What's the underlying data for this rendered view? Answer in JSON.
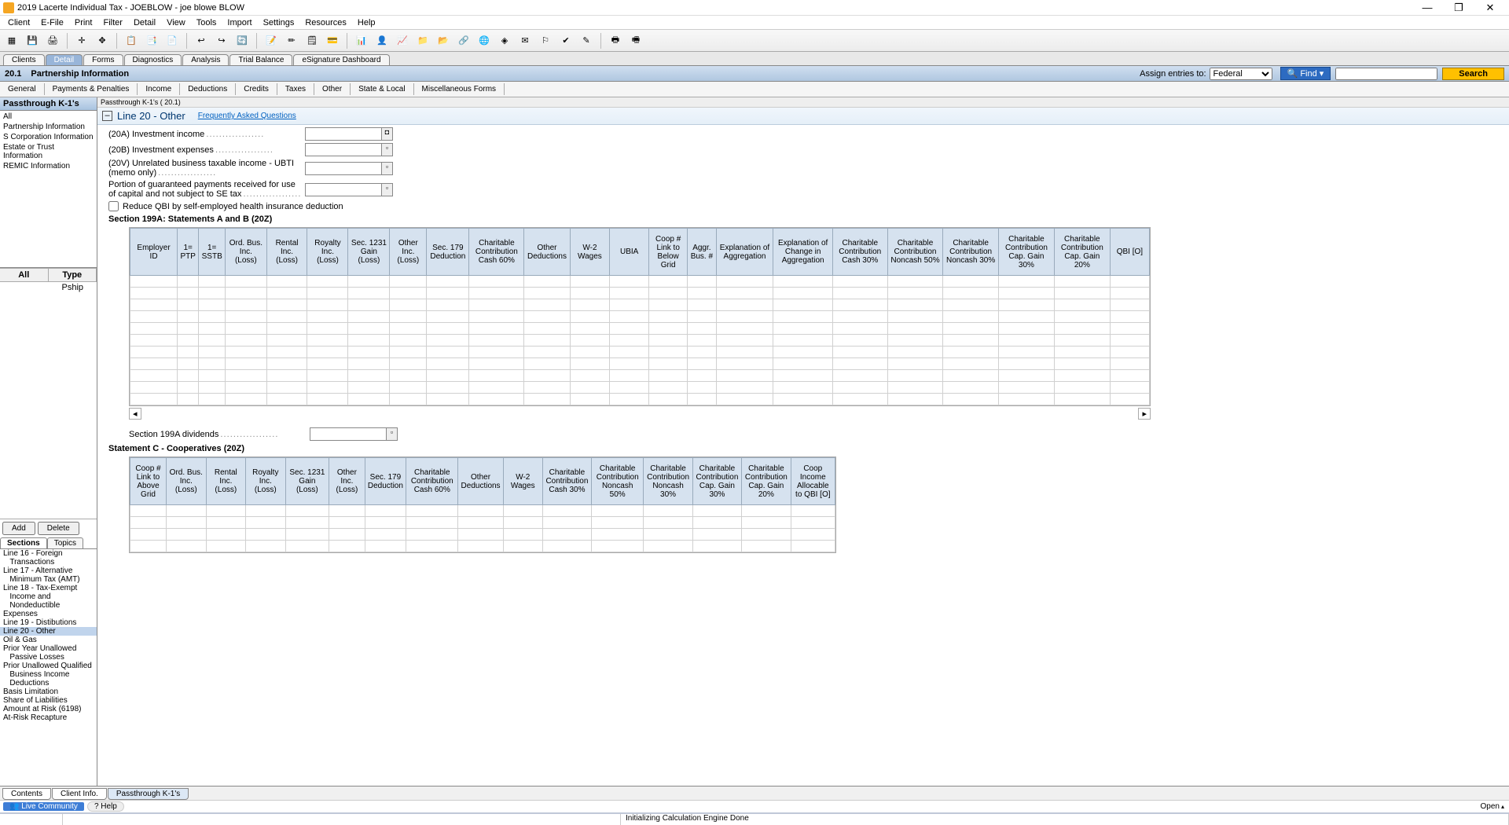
{
  "window": {
    "title": "2019 Lacerte Individual Tax - JOEBLOW - joe blowe BLOW"
  },
  "menu": [
    "Client",
    "E-File",
    "Print",
    "Filter",
    "Detail",
    "View",
    "Tools",
    "Import",
    "Settings",
    "Resources",
    "Help"
  ],
  "nav_tabs": [
    "Clients",
    "Detail",
    "Forms",
    "Diagnostics",
    "Analysis",
    "Trial Balance",
    "eSignature Dashboard"
  ],
  "nav_active": 1,
  "header": {
    "id": "20.1",
    "title": "Partnership Information",
    "assign_label": "Assign entries to:",
    "assign_value": "Federal",
    "find_label": "Find ▾",
    "search_label": "Search"
  },
  "sub_tabs": [
    "General",
    "Payments & Penalties",
    "Income",
    "Deductions",
    "Credits",
    "Taxes",
    "Other",
    "State & Local",
    "Miscellaneous Forms"
  ],
  "left": {
    "panel1_title": "Passthrough K-1's",
    "panel1_items": [
      "All",
      "Partnership Information",
      "S Corporation Information",
      "Estate or Trust Information",
      "REMIC Information"
    ],
    "grid_cols": [
      "All",
      "Type"
    ],
    "grid_row_type": "Pship",
    "add": "Add",
    "delete": "Delete",
    "sec_tabs": [
      "Sections",
      "Topics"
    ],
    "sections": [
      "Line 16 - Foreign\n   Transactions",
      "Line 17 - Alternative\n   Minimum Tax (AMT)",
      "Line 18 - Tax-Exempt\n   Income and\n   Nondeductible Expenses",
      "Line 19 - Distibutions",
      "Line 20 - Other",
      "Oil & Gas",
      "Prior Year Unallowed\n   Passive Losses",
      "Prior Unallowed Qualified\n   Business Income\n   Deductions",
      "Basis Limitation",
      "Share of Liabilities",
      "Amount at Risk (6198)",
      "At-Risk Recapture"
    ],
    "sections_sel": 4
  },
  "content": {
    "crumb": "Passthrough K-1's  ( 20.1)",
    "title": "Line 20 - Other",
    "faq": "Frequently Asked Questions",
    "fields": [
      "(20A) Investment income",
      "(20B) Investment expenses",
      "(20V) Unrelated business taxable income - UBTI (memo only)",
      "Portion of guaranteed payments received for use of capital and not subject to SE tax"
    ],
    "chk": "Reduce QBI by self-employed health insurance deduction",
    "sec199_title": "Section 199A: Statements A and B (20Z)",
    "tbl1_cols": [
      "Employer ID",
      "1= PTP",
      "1= SSTB",
      "Ord. Bus. Inc. (Loss)",
      "Rental Inc. (Loss)",
      "Royalty Inc. (Loss)",
      "Sec. 1231 Gain (Loss)",
      "Other Inc. (Loss)",
      "Sec. 179 Deduction",
      "Charitable Contribution Cash 60%",
      "Other Deductions",
      "W-2 Wages",
      "UBIA",
      "Coop # Link to Below Grid",
      "Aggr. Bus. #",
      "Explanation of Aggregation",
      "Explanation of Change in Aggregation",
      "Charitable Contribution Cash 30%",
      "Charitable Contribution Noncash 50%",
      "Charitable Contribution Noncash 30%",
      "Charitable Contribution Cap. Gain 30%",
      "Charitable Contribution Cap. Gain 20%",
      "QBI [O]"
    ],
    "dividends_lbl": "Section 199A dividends",
    "stmt_c_title": "Statement C - Cooperatives (20Z)",
    "tbl2_cols": [
      "Coop # Link to Above Grid",
      "Ord. Bus. Inc. (Loss)",
      "Rental Inc. (Loss)",
      "Royalty Inc. (Loss)",
      "Sec. 1231 Gain (Loss)",
      "Other Inc. (Loss)",
      "Sec. 179 Deduction",
      "Charitable Contribution Cash 60%",
      "Other Deductions",
      "W-2 Wages",
      "Charitable Contribution Cash 30%",
      "Charitable Contribution Noncash 50%",
      "Charitable Contribution Noncash 30%",
      "Charitable Contribution Cap. Gain 30%",
      "Charitable Contribution Cap. Gain 20%",
      "Coop Income Allocable to QBI [O]"
    ]
  },
  "bottom_tabs": [
    "Contents",
    "Client Info.",
    "Passthrough K-1's"
  ],
  "status": {
    "community": "Live Community",
    "help": "Help",
    "open": "Open"
  },
  "footer": {
    "msg": "Initializing Calculation Engine Done"
  }
}
